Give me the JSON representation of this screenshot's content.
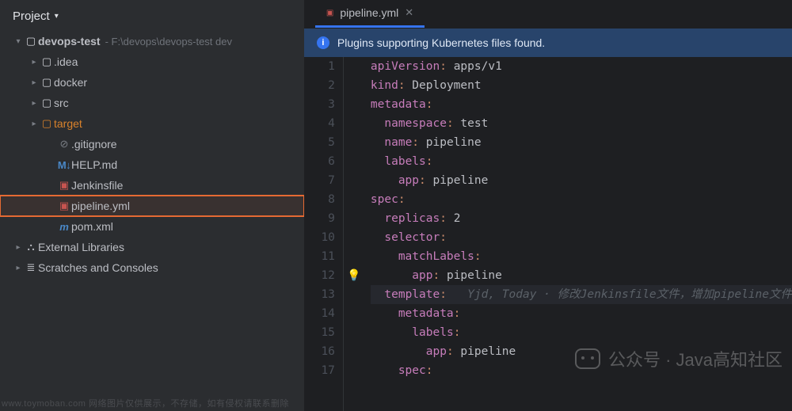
{
  "header": {
    "title": "Project"
  },
  "tree": {
    "root": {
      "name": "devops-test",
      "path": "- F:\\devops\\devops-test dev"
    },
    "items": [
      {
        "label": ".idea",
        "kind": "folder",
        "expandable": true
      },
      {
        "label": "docker",
        "kind": "folder",
        "expandable": true
      },
      {
        "label": "src",
        "kind": "folder",
        "expandable": true
      },
      {
        "label": "target",
        "kind": "folder-orange",
        "expandable": true
      },
      {
        "label": ".gitignore",
        "kind": "ignore"
      },
      {
        "label": "HELP.md",
        "kind": "md"
      },
      {
        "label": "Jenkinsfile",
        "kind": "yaml"
      },
      {
        "label": "pipeline.yml",
        "kind": "yaml",
        "highlight": true
      },
      {
        "label": "pom.xml",
        "kind": "xml"
      }
    ],
    "external": "External Libraries",
    "scratches": "Scratches and Consoles"
  },
  "tab": {
    "label": "pipeline.yml"
  },
  "banner": {
    "text": "Plugins supporting Kubernetes files found."
  },
  "code": {
    "current_line": 13,
    "lines": [
      {
        "n": 1,
        "seg": [
          [
            "k",
            "apiVersion"
          ],
          [
            "colon",
            ": "
          ],
          [
            "v",
            "apps/v1"
          ]
        ]
      },
      {
        "n": 2,
        "seg": [
          [
            "k",
            "kind"
          ],
          [
            "colon",
            ": "
          ],
          [
            "v",
            "Deployment"
          ]
        ]
      },
      {
        "n": 3,
        "seg": [
          [
            "k",
            "metadata"
          ],
          [
            "colon",
            ":"
          ]
        ]
      },
      {
        "n": 4,
        "seg": [
          [
            "v",
            "  "
          ],
          [
            "k",
            "namespace"
          ],
          [
            "colon",
            ": "
          ],
          [
            "v",
            "test"
          ]
        ]
      },
      {
        "n": 5,
        "seg": [
          [
            "v",
            "  "
          ],
          [
            "k",
            "name"
          ],
          [
            "colon",
            ": "
          ],
          [
            "v",
            "pipeline"
          ]
        ]
      },
      {
        "n": 6,
        "seg": [
          [
            "v",
            "  "
          ],
          [
            "k",
            "labels"
          ],
          [
            "colon",
            ":"
          ]
        ]
      },
      {
        "n": 7,
        "seg": [
          [
            "v",
            "    "
          ],
          [
            "k",
            "app"
          ],
          [
            "colon",
            ": "
          ],
          [
            "v",
            "pipeline"
          ]
        ]
      },
      {
        "n": 8,
        "seg": [
          [
            "k",
            "spec"
          ],
          [
            "colon",
            ":"
          ]
        ]
      },
      {
        "n": 9,
        "seg": [
          [
            "v",
            "  "
          ],
          [
            "k",
            "replicas"
          ],
          [
            "colon",
            ": "
          ],
          [
            "v",
            "2"
          ]
        ]
      },
      {
        "n": 10,
        "seg": [
          [
            "v",
            "  "
          ],
          [
            "k",
            "selector"
          ],
          [
            "colon",
            ":"
          ]
        ]
      },
      {
        "n": 11,
        "seg": [
          [
            "v",
            "    "
          ],
          [
            "k",
            "matchLabels"
          ],
          [
            "colon",
            ":"
          ]
        ]
      },
      {
        "n": 12,
        "seg": [
          [
            "v",
            "      "
          ],
          [
            "k",
            "app"
          ],
          [
            "colon",
            ": "
          ],
          [
            "v",
            "pipeline"
          ]
        ]
      },
      {
        "n": 13,
        "seg": [
          [
            "v",
            "  "
          ],
          [
            "k",
            "template"
          ],
          [
            "colon",
            ":"
          ]
        ],
        "inline": "   Yjd, Today · 修改Jenkinsfile文件，增加pipeline文件"
      },
      {
        "n": 14,
        "seg": [
          [
            "v",
            "    "
          ],
          [
            "k",
            "metadata"
          ],
          [
            "colon",
            ":"
          ]
        ]
      },
      {
        "n": 15,
        "seg": [
          [
            "v",
            "      "
          ],
          [
            "k",
            "labels"
          ],
          [
            "colon",
            ":"
          ]
        ]
      },
      {
        "n": 16,
        "seg": [
          [
            "v",
            "        "
          ],
          [
            "k",
            "app"
          ],
          [
            "colon",
            ": "
          ],
          [
            "v",
            "pipeline"
          ]
        ]
      },
      {
        "n": 17,
        "seg": [
          [
            "v",
            "    "
          ],
          [
            "k",
            "spec"
          ],
          [
            "colon",
            ":"
          ]
        ]
      }
    ]
  },
  "watermark": "公众号 · Java高知社区",
  "footer": "www.toymoban.com 网络图片仅供展示，不存储，如有侵权请联系删除"
}
